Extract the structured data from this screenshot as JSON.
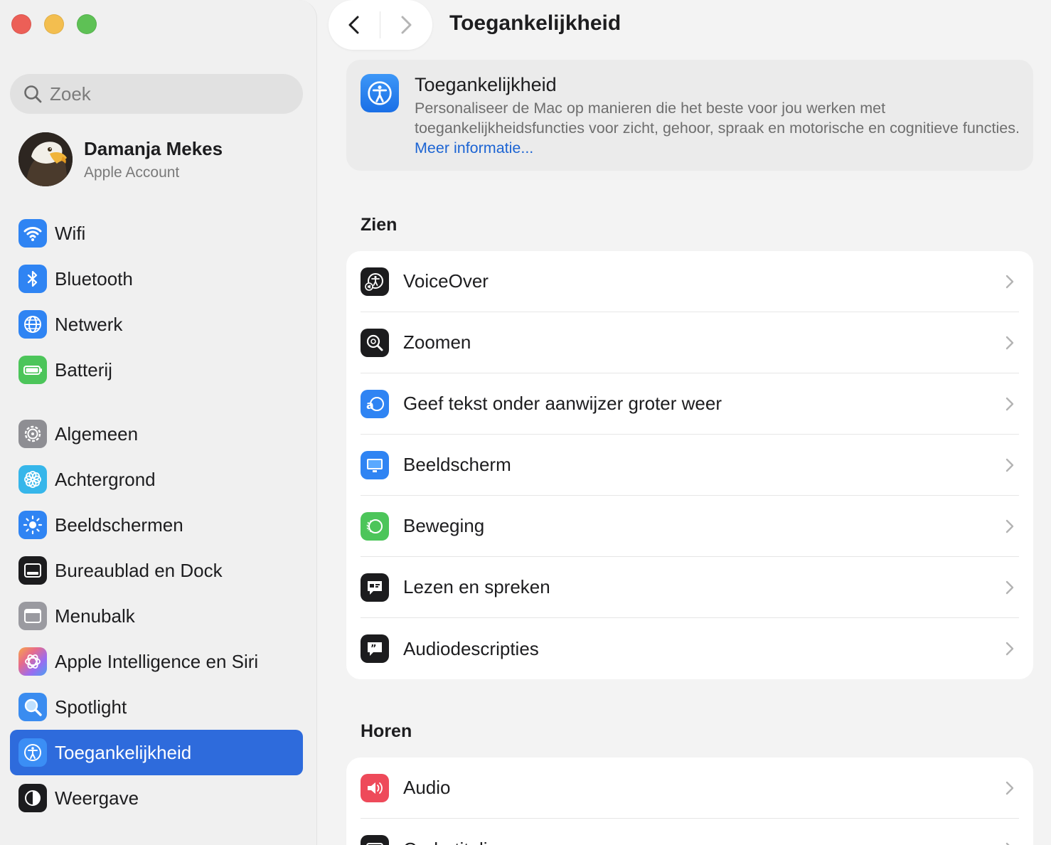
{
  "sidebar": {
    "search_placeholder": "Zoek",
    "account": {
      "name": "Damanja Mekes",
      "subtitle": "Apple Account"
    },
    "group1": [
      {
        "label": "Wifi",
        "icon": "wifi-icon",
        "color": "#2f84f3"
      },
      {
        "label": "Bluetooth",
        "icon": "bluetooth-icon",
        "color": "#2f84f3"
      },
      {
        "label": "Netwerk",
        "icon": "globe-icon",
        "color": "#2f84f3"
      },
      {
        "label": "Batterij",
        "icon": "battery-icon",
        "color": "#4cc55a"
      }
    ],
    "group2": [
      {
        "label": "Algemeen",
        "icon": "gear-icon",
        "color": "#8e8e93"
      },
      {
        "label": "Achtergrond",
        "icon": "flower-icon",
        "color": "#36b6ea"
      },
      {
        "label": "Beeldschermen",
        "icon": "sun-icon",
        "color": "#2f84f3"
      },
      {
        "label": "Bureaublad en Dock",
        "icon": "dock-icon",
        "color": "#1c1c1e"
      },
      {
        "label": "Menubalk",
        "icon": "menubar-icon",
        "color": "#9a9aa0"
      },
      {
        "label": "Apple Intelligence en Siri",
        "icon": "siri-icon",
        "color": "#e76c8a"
      },
      {
        "label": "Spotlight",
        "icon": "magnifier-icon",
        "color": "#3a8cf0"
      },
      {
        "label": "Toegankelijkheid",
        "icon": "accessibility-icon",
        "color": "#2f84f3",
        "selected": true
      },
      {
        "label": "Weergave",
        "icon": "appearance-icon",
        "color": "#1c1c1e"
      }
    ]
  },
  "header": {
    "title": "Toegankelijkheid"
  },
  "hero": {
    "title": "Toegankelijkheid",
    "description": "Personaliseer de Mac op manieren die het beste voor jou werken met toegankelijkheidsfuncties voor zicht, gehoor, spraak en motorische en cognitieve functies.",
    "link": "Meer informatie..."
  },
  "sections": {
    "zien": {
      "title": "Zien",
      "items": [
        {
          "label": "VoiceOver",
          "icon": "voiceover-icon",
          "color": "#1c1c1e"
        },
        {
          "label": "Zoomen",
          "icon": "zoom-icon",
          "color": "#1c1c1e"
        },
        {
          "label": "Geef tekst onder aanwijzer groter weer",
          "icon": "hover-text-icon",
          "color": "#2f84f3"
        },
        {
          "label": "Beeldscherm",
          "icon": "display-icon",
          "color": "#2f84f3"
        },
        {
          "label": "Beweging",
          "icon": "motion-icon",
          "color": "#4cc55a"
        },
        {
          "label": "Lezen en spreken",
          "icon": "speech-bubble-icon",
          "color": "#1c1c1e"
        },
        {
          "label": "Audiodescripties",
          "icon": "quote-bubble-icon",
          "color": "#1c1c1e"
        }
      ]
    },
    "horen": {
      "title": "Horen",
      "items": [
        {
          "label": "Audio",
          "icon": "speaker-icon",
          "color": "#ee4a5a"
        },
        {
          "label": "Ondertiteling",
          "icon": "captions-icon",
          "color": "#1c1c1e"
        }
      ]
    }
  }
}
